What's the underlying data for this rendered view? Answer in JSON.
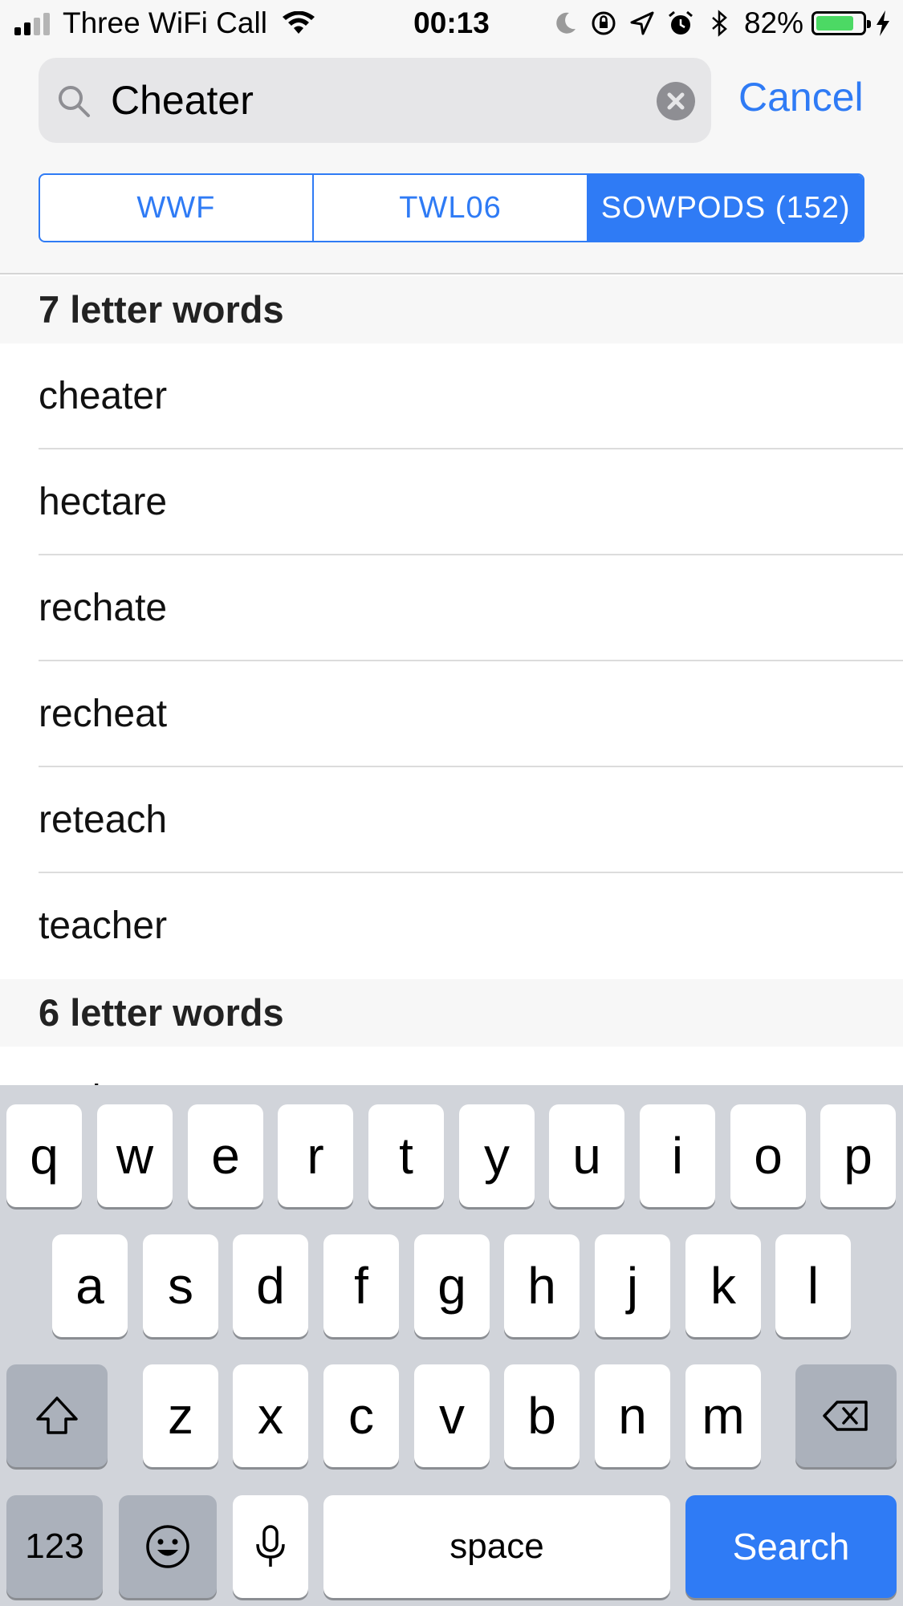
{
  "status_bar": {
    "carrier": "Three WiFi Call",
    "time": "00:13",
    "battery_percent": "82%",
    "battery_level": 0.82,
    "battery_color": "#4cd964"
  },
  "search": {
    "value": "Cheater",
    "placeholder": "",
    "cancel_label": "Cancel"
  },
  "segments": [
    {
      "label": "WWF",
      "active": false
    },
    {
      "label": "TWL06",
      "active": false
    },
    {
      "label": "SOWPODS (152)",
      "active": true
    }
  ],
  "sections": [
    {
      "title": "7 letter words",
      "words": [
        "cheater",
        "hectare",
        "rechate",
        "recheat",
        "reteach",
        "teacher"
      ]
    },
    {
      "title": "6 letter words",
      "words": [
        "aether"
      ]
    }
  ],
  "keyboard": {
    "row1": [
      "q",
      "w",
      "e",
      "r",
      "t",
      "y",
      "u",
      "i",
      "o",
      "p"
    ],
    "row2": [
      "a",
      "s",
      "d",
      "f",
      "g",
      "h",
      "j",
      "k",
      "l"
    ],
    "row3": [
      "z",
      "x",
      "c",
      "v",
      "b",
      "n",
      "m"
    ],
    "numbers_label": "123",
    "space_label": "space",
    "search_label": "Search"
  },
  "colors": {
    "accent": "#2f7bf5",
    "keyboard_bg": "#d1d4da",
    "dark_key": "#abb1bb"
  }
}
